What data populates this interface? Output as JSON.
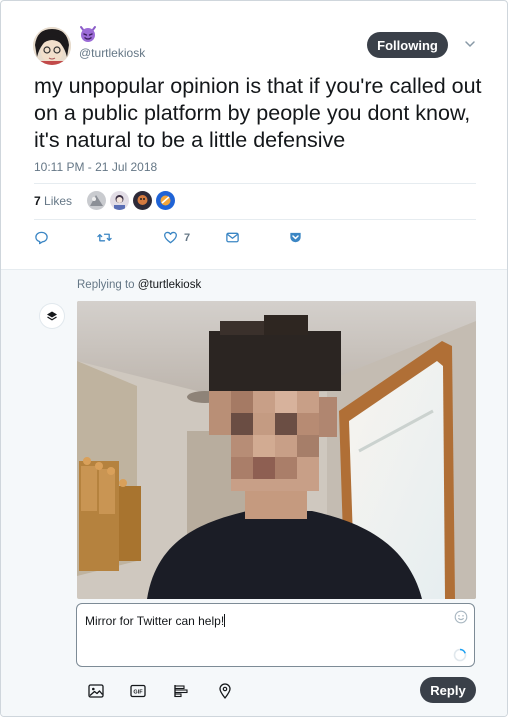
{
  "tweet": {
    "author_handle": "@turtlekiosk",
    "follow_button_label": "Following",
    "text": "my unpopular opinion is that if you're called out on a public platform by people you dont know, it's natural to be a little defensive",
    "timestamp": "10:11 PM - 21 Jul 2018",
    "likes_count": "7",
    "likes_label": "Likes",
    "like_action_count": "7",
    "icons": [
      "devil-emoji-icon",
      "chevron-down-icon",
      "reply-icon",
      "retweet-icon",
      "like-icon",
      "message-icon",
      "pocket-icon"
    ]
  },
  "reply": {
    "replying_to_prefix": "Replying to",
    "replying_to_handle": "@turtlekiosk",
    "compose_text": "Mirror for Twitter can help!",
    "reply_button_label": "Reply",
    "toolbar_icons": [
      "image-icon",
      "gif-icon",
      "poll-icon",
      "location-icon"
    ]
  },
  "colors": {
    "dark_button": "#3a4049",
    "muted_text": "#657786",
    "reply_background": "#f5f8fa",
    "like_blue": "#1da1f2"
  }
}
